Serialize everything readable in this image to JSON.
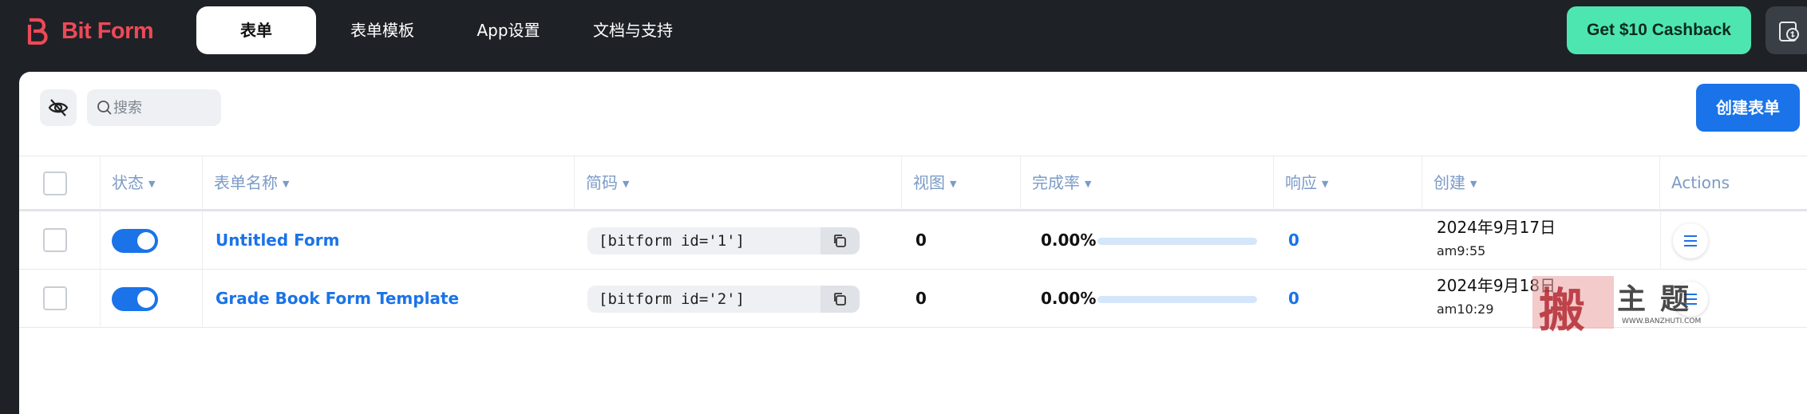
{
  "brand": {
    "name": "Bit Form",
    "accent": "#ee4957"
  },
  "nav": {
    "tabs": [
      {
        "label": "表单",
        "active": true
      },
      {
        "label": "表单模板",
        "active": false
      },
      {
        "label": "App设置",
        "active": false
      },
      {
        "label": "文档与支持",
        "active": false
      }
    ],
    "cashback_label": "Get $10 Cashback",
    "side_icon": "clipboard-dollar-icon"
  },
  "toolbar": {
    "search_placeholder": "搜索",
    "create_label": "创建表单",
    "icons": [
      "eye-off-icon",
      "search-icon"
    ]
  },
  "table": {
    "columns": [
      {
        "label": "状态",
        "sortable": true
      },
      {
        "label": "表单名称",
        "sortable": true
      },
      {
        "label": "简码",
        "sortable": true
      },
      {
        "label": "视图",
        "sortable": true
      },
      {
        "label": "完成率",
        "sortable": true
      },
      {
        "label": "响应",
        "sortable": true
      },
      {
        "label": "创建",
        "sortable": true
      },
      {
        "label": "Actions",
        "sortable": false
      }
    ],
    "rows": [
      {
        "enabled": true,
        "name": "Untitled Form",
        "shortcode": "[bitform id='1']",
        "views": "0",
        "completion": "0.00%",
        "completion_value": 0,
        "responses": "0",
        "created_date": "2024年9月17日",
        "created_time": "am9:55"
      },
      {
        "enabled": true,
        "name": "Grade Book Form Template",
        "shortcode": "[bitform id='2']",
        "views": "0",
        "completion": "0.00%",
        "completion_value": 0,
        "responses": "0",
        "created_date": "2024年9月18日",
        "created_time": "am10:29"
      }
    ]
  },
  "watermark": {
    "title": "主题",
    "url": "WWW.BANZHUTI.COM"
  },
  "colors": {
    "primary": "#1a73e8",
    "cashback": "#4ee6b0",
    "header_bg": "#1e2227"
  }
}
